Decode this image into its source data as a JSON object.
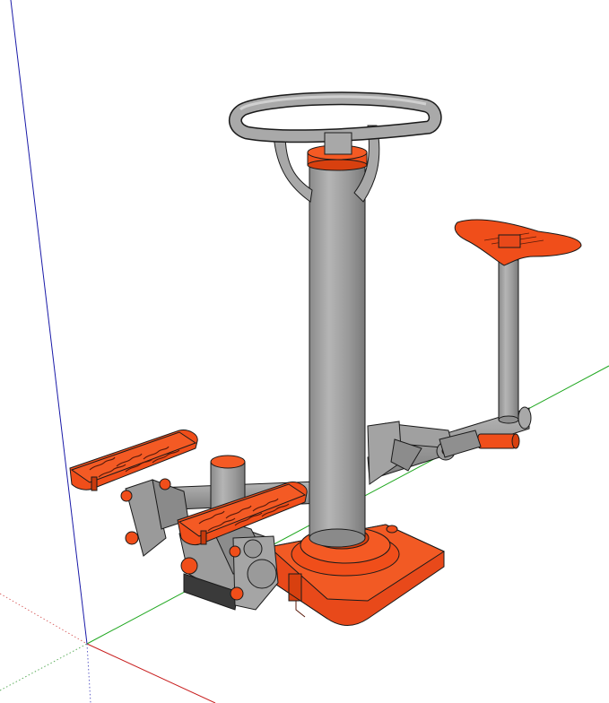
{
  "scene": {
    "background": "#ffffff",
    "colors": {
      "metal": "#9b9b9b",
      "metal_dark": "#7d7d7d",
      "metal_light": "#c4c4c4",
      "plastic": "#f04e1a",
      "plastic_dark": "#c93a0c",
      "axis_red": "#d40000",
      "axis_green": "#00a000",
      "axis_blue": "#0000c0",
      "outline": "#1a1a1a"
    },
    "objects": [
      "axis-red",
      "axis-green",
      "axis-blue",
      "stepper-machine",
      "seat",
      "handlebar",
      "central-column",
      "base-plate",
      "foot-pedals"
    ]
  }
}
